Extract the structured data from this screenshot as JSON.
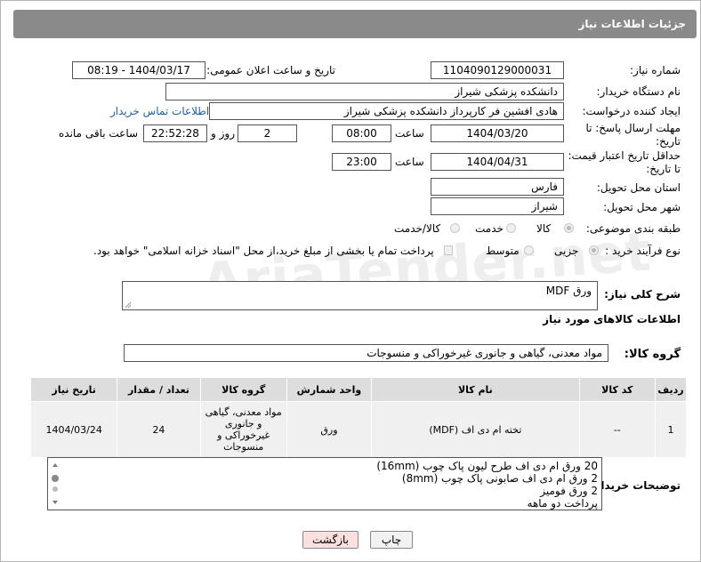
{
  "header": {
    "title": "جزئیات اطلاعات نیاز"
  },
  "watermark": "AriaTender.net",
  "fields": {
    "need_number_label": "شماره نیاز:",
    "need_number": "1104090129000031",
    "announce_label": "تاریخ و ساعت اعلان عمومی:",
    "announce_value": "1404/03/17 - 08:19",
    "buyer_org_label": "نام دستگاه خریدار:",
    "buyer_org": "دانشکده پزشکی شیراز",
    "creator_label": "ایجاد کننده درخواست:",
    "creator": "هادی افشین فر کارپرداز دانشکده پزشکی شیراز",
    "contact_link": "اطلاعات تماس خریدار",
    "deadline_label_1": "مهلت ارسال پاسخ: تا",
    "deadline_label_2": "تاریخ:",
    "deadline_date": "1404/03/20",
    "time_label": "ساعت",
    "deadline_time": "08:00",
    "days_value": "2",
    "days_label": "روز و",
    "remaining_time": "22:52:28",
    "remaining_label": "ساعت باقی مانده",
    "min_validity_label_1": "حداقل تاریخ اعتبار قیمت:",
    "min_validity_label_2": "تا تاریخ:",
    "validity_date": "1404/04/31",
    "validity_time": "23:00",
    "province_label": "استان محل تحویل:",
    "province": "فارس",
    "city_label": "شهر محل تحویل:",
    "city": "شیراز",
    "category_label": "طبقه بندی موضوعی:",
    "category_options": [
      "کالا",
      "خدمت",
      "کالا/خدمت"
    ],
    "purchase_type_label": "نوع فرآیند خرید :",
    "purchase_options": [
      "جزیی",
      "متوسط"
    ],
    "payment_note": "پرداخت تمام یا بخشی از مبلغ خرید،از محل \"اسناد خزانه اسلامی\" خواهد بود."
  },
  "summary": {
    "label": "شرح کلی نیاز:",
    "value": "ورق MDF"
  },
  "items_section": {
    "title": "اطلاعات کالاهای مورد نیاز",
    "group_label": "گروه کالا:",
    "group_value": "مواد معدنی، گیاهی و جانوری غیرخوراکی و منسوجات"
  },
  "table": {
    "headers": [
      "ردیف",
      "کد کالا",
      "نام کالا",
      "واحد شمارش",
      "گروه کالا",
      "تعداد / مقدار",
      "تاریخ نیاز"
    ],
    "rows": [
      {
        "row": "1",
        "code": "--",
        "name": "تخته ام دی اف (MDF)",
        "unit": "ورق",
        "group": "مواد معدنی، گیاهی و جانوری غیرخوراکی و منسوجات",
        "qty": "24",
        "date": "1404/03/24"
      }
    ]
  },
  "notes": {
    "label": "توضیحات خریدار:",
    "lines": [
      "20 ورق ام دی اف طرح لیون پاک چوب (16mm)",
      "2 ورق ام دی اف صابونی پاک چوب (8mm)",
      "2 ورق فومیز",
      "پرداخت دو ماهه"
    ]
  },
  "buttons": {
    "print": "چاپ",
    "back": "بازگشت"
  }
}
